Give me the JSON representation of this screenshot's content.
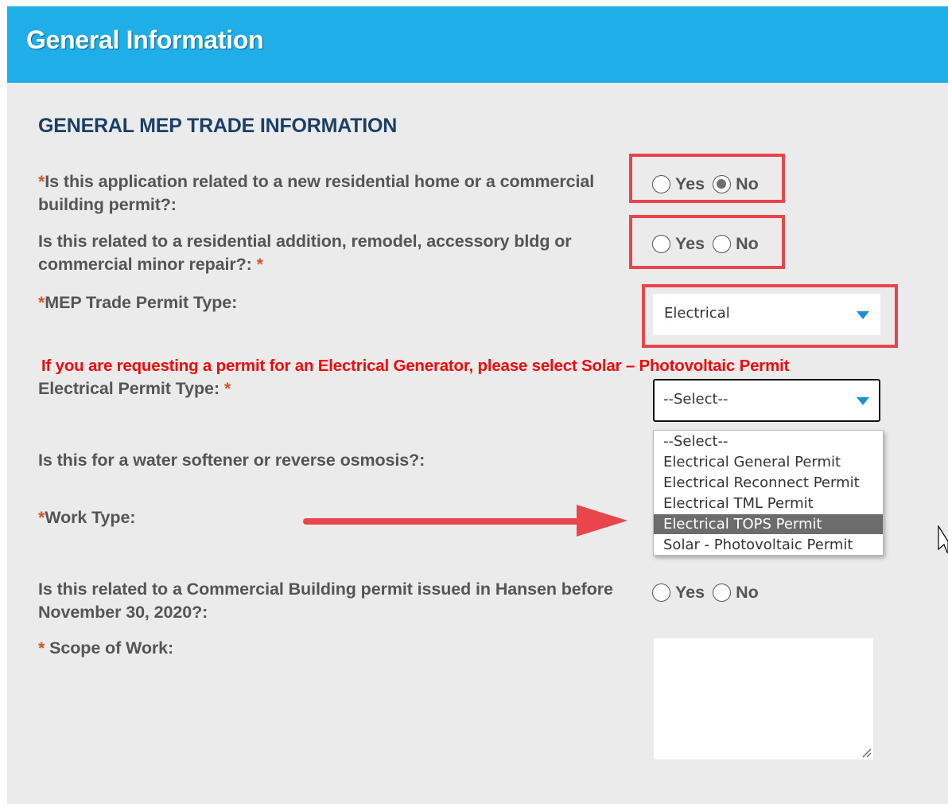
{
  "header": {
    "title": "General Information"
  },
  "section": {
    "title": "GENERAL MEP TRADE INFORMATION"
  },
  "required_marker": "*",
  "q1": {
    "label": "Is this application related to a new residential home or a commercial building permit?:",
    "options": [
      "Yes",
      "No"
    ],
    "selected": "No"
  },
  "q2": {
    "label": "Is this related to a residential addition, remodel, accessory bldg or commercial minor repair?:",
    "options": [
      "Yes",
      "No"
    ],
    "selected": null
  },
  "mep_type": {
    "label": "MEP Trade Permit Type:",
    "value": "Electrical"
  },
  "note": "If you are requesting a permit for an Electrical Generator, please select Solar – Photovoltaic Permit",
  "electrical_type": {
    "label": "Electrical Permit Type:",
    "value": "--Select--",
    "options": [
      "--Select--",
      "Electrical General Permit",
      "Electrical Reconnect Permit",
      "Electrical TML Permit",
      "Electrical TOPS Permit",
      "Solar - Photovoltaic Permit"
    ],
    "highlighted": "Electrical TOPS Permit"
  },
  "water_softener": {
    "label": "Is this for a water softener or reverse osmosis?:"
  },
  "work_type": {
    "label": "Work Type:"
  },
  "hansen": {
    "label": "Is this related to a Commercial Building permit issued in Hansen before November 30, 2020?:",
    "options": [
      "Yes",
      "No"
    ],
    "selected": null
  },
  "scope": {
    "label": "Scope of Work:",
    "value": ""
  },
  "colors": {
    "header": "#1faee8",
    "section_title": "#1c3f66",
    "required": "#d9532c",
    "note": "#f5070a",
    "highlight": "#e8454d",
    "caret": "#1e8fd6",
    "selected_option": "#6c6c6c"
  }
}
